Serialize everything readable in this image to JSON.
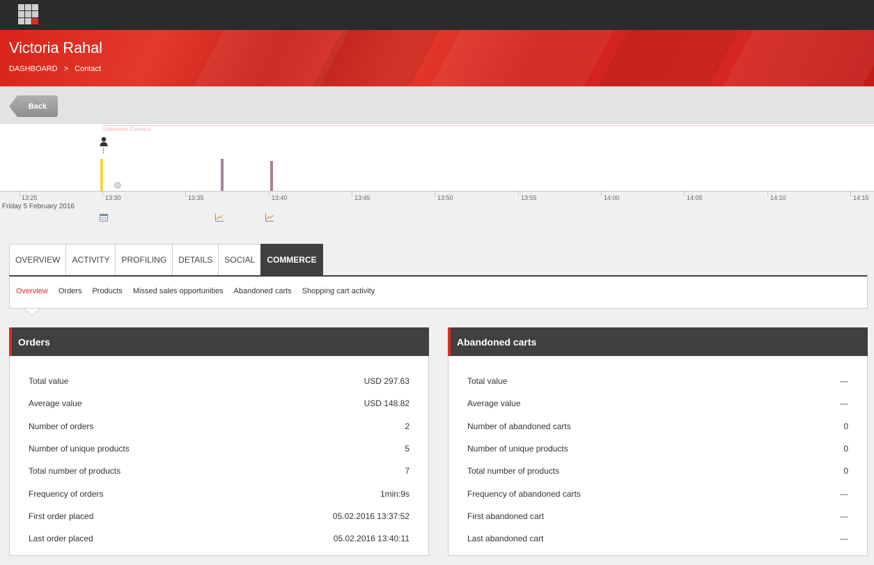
{
  "header": {
    "title": "Victoria Rahal",
    "breadcrumb": {
      "root": "DASHBOARD",
      "separator": ">",
      "current": "Contact"
    }
  },
  "toolbar": {
    "back_label": "Back"
  },
  "timeline": {
    "lane_label": "Unknown Contact",
    "date": "Friday 5 February 2016",
    "ticks": [
      "13:25",
      "13:30",
      "13:35",
      "13:40",
      "13:45",
      "13:50",
      "13:55",
      "14:00",
      "14:05",
      "14:10",
      "14:15"
    ],
    "icons": [
      "person-icon",
      "calendar-icon",
      "chart-icon"
    ],
    "colors": {
      "visit": "#f5d53a",
      "order": "#a7809d",
      "lane": "#f4c5c5"
    }
  },
  "tabs": [
    "OVERVIEW",
    "ACTIVITY",
    "PROFILING",
    "DETAILS",
    "SOCIAL",
    "COMMERCE"
  ],
  "active_tab": "COMMERCE",
  "subnav": [
    "Overview",
    "Orders",
    "Products",
    "Missed sales opportunities",
    "Abandoned carts",
    "Shopping cart activity"
  ],
  "active_subnav": "Overview",
  "orders": {
    "title": "Orders",
    "rows": [
      {
        "label": "Total value",
        "value": "USD 297.63"
      },
      {
        "label": "Average value",
        "value": "USD 148.82"
      },
      {
        "label": "Number of orders",
        "value": "2"
      },
      {
        "label": "Number of unique products",
        "value": "5"
      },
      {
        "label": "Total number of products",
        "value": "7"
      },
      {
        "label": "Frequency of orders",
        "value": "1min:9s"
      },
      {
        "label": "First order placed",
        "value": "05.02.2016 13:37:52"
      },
      {
        "label": "Last order placed",
        "value": "05.02.2016 13:40:11"
      }
    ]
  },
  "abandoned_carts": {
    "title": "Abandoned carts",
    "rows": [
      {
        "label": "Total value",
        "value": "---"
      },
      {
        "label": "Average value",
        "value": "---"
      },
      {
        "label": "Number of abandoned carts",
        "value": "0"
      },
      {
        "label": "Number of unique products",
        "value": "0"
      },
      {
        "label": "Total number of products",
        "value": "0"
      },
      {
        "label": "Frequency of abandoned carts",
        "value": "---"
      },
      {
        "label": "First abandoned cart",
        "value": "---"
      },
      {
        "label": "Last abandoned cart",
        "value": "---"
      }
    ]
  },
  "brand_color": "#e02b20"
}
